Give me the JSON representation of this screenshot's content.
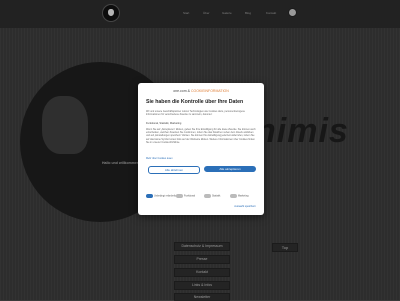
{
  "nav": {
    "items": [
      "Start",
      "Über",
      "Galerie",
      "Blog",
      "Kontakt"
    ]
  },
  "hero": {
    "word": "nimis"
  },
  "page": {
    "heading": "Hallo und willkommen",
    "footer_buttons": [
      "Datenschutz & Impressum",
      "Presse",
      "Kontakt",
      "Links & Infos",
      "Newsletter"
    ],
    "small_button": "Top"
  },
  "consent": {
    "brand_main": "one.com",
    "brand_amp": "&",
    "brand_accent": "COOKIEINFORMATION",
    "title": "Sie haben die Kontrolle über Ihre Daten",
    "intro": "Wir und unsere Geschäftspartner nutzen Technologien wie Cookies dazu, personenbezogene Informationen für verschiedene Zwecke zu sammeln, darunter:",
    "purposes": "Funktional, Statistik, Marketing",
    "body": "Wenn Sie auf „Akzeptieren“ klicken, geben Sie Ihre Einwilligung für alle diese Zwecke. Sie können auch entscheiden, welchen Zwecken Sie zustimmen, indem Sie das Kästchen neben dem Zweck anklicken und auf „Einstellungen speichern“ klicken. Sie können Ihre Einwilligung jederzeit widerrufen, indem Sie auf das kleine Symbol unten links auf der Webseite klicken. Weitere Informationen über Cookies finden Sie in unserer Cookie-Richtlinie.",
    "more_link": "Mehr über Cookies lesen",
    "decline": "Alle ablehnen",
    "accept": "Alle akzeptieren",
    "toggles": [
      "Unbedingt erforderlich",
      "Funktional",
      "Statistik",
      "Marketing"
    ],
    "save_link": "Auswahl speichern"
  }
}
